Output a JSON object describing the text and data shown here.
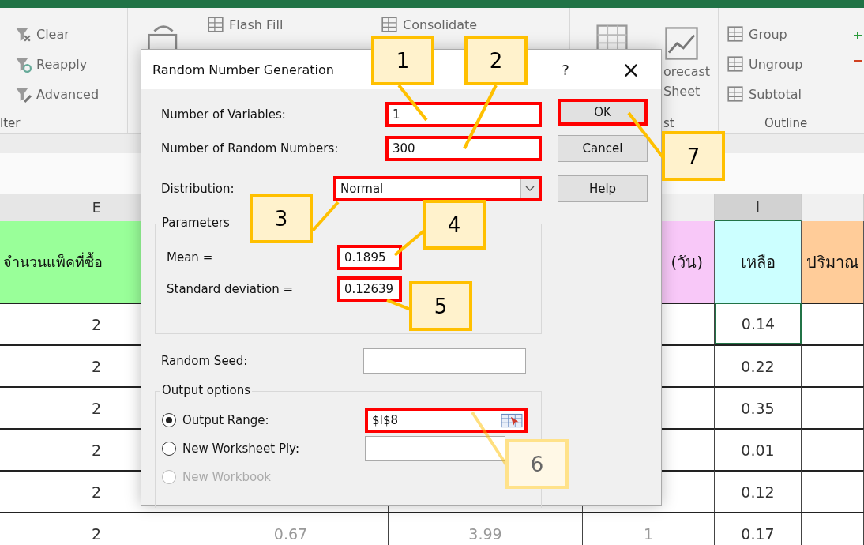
{
  "ribbon": {
    "groups": [
      {
        "kind": "small",
        "label": "lter",
        "items": [
          {
            "label": "Clear"
          },
          {
            "label": "Reapply"
          },
          {
            "label": "Advanced"
          }
        ]
      },
      {
        "kind": "small",
        "items": [
          {
            "label": "Flash Fill"
          },
          {
            "label": "Consolidate"
          }
        ]
      },
      {
        "kind": "large",
        "label": "st",
        "buttons": [
          {
            "lines": [
              "orecast",
              "Sheet"
            ]
          }
        ]
      },
      {
        "kind": "small",
        "label": "Outline",
        "items": [
          {
            "label": "Group"
          },
          {
            "label": "Ungroup"
          },
          {
            "label": "Subtotal"
          }
        ]
      }
    ]
  },
  "sheet": {
    "column_headers": [
      {
        "letter": "E",
        "selected": false
      },
      {
        "letter": "I",
        "selected": true
      }
    ],
    "header_cells": [
      {
        "text": "จำนวนแพ็คที่ซื้อ",
        "color": "#99ff99"
      },
      {
        "text": "(วัน)",
        "color": "#f8c8f8"
      },
      {
        "text": "เหลือ",
        "color": "#ccffff"
      },
      {
        "text": "ปริมาณ",
        "color": "#ffcc99"
      }
    ],
    "rows": [
      {
        "cells": [
          "2",
          null,
          null,
          null,
          "0.14",
          null
        ],
        "selected": true
      },
      {
        "cells": [
          "2",
          null,
          null,
          null,
          "0.22",
          null
        ],
        "selected": false
      },
      {
        "cells": [
          "2",
          null,
          null,
          null,
          "0.35",
          null
        ],
        "selected": false
      },
      {
        "cells": [
          "2",
          null,
          null,
          null,
          "0.01",
          null
        ],
        "selected": false
      },
      {
        "cells": [
          "2",
          null,
          null,
          null,
          "0.12",
          null
        ],
        "selected": false
      },
      {
        "cells": [
          "2",
          "0.67",
          "3.99",
          "1",
          "0.17",
          null
        ],
        "selected": false
      }
    ]
  },
  "dialog": {
    "title": "Random Number Generation",
    "help": "?",
    "close": "×",
    "fields": [
      {
        "label": "Number of Variables:",
        "value": "1",
        "highlighted": true
      },
      {
        "label": "Number of Random Numbers:",
        "value": "300",
        "highlighted": true
      }
    ],
    "distribution": {
      "label": "Distribution:",
      "value": "Normal",
      "highlighted": true
    },
    "parameters": {
      "title": "Parameters",
      "fields": [
        {
          "label": "Mean =",
          "value": "0.1895",
          "highlighted": true
        },
        {
          "label": "Standard deviation =",
          "value": "0.12639",
          "highlighted": true
        }
      ]
    },
    "random_seed": {
      "label": "Random Seed:",
      "highlighted": false
    },
    "output": {
      "title": "Output options",
      "options": [
        {
          "label": "Output Range:",
          "selected": true,
          "disabled": false,
          "field": {
            "kind": "range",
            "value": "$I$8",
            "highlighted": true
          }
        },
        {
          "label": "New Worksheet Ply:",
          "selected": false,
          "disabled": false,
          "field": {
            "kind": "text",
            "highlighted": false
          }
        },
        {
          "label": "New Workbook",
          "selected": false,
          "disabled": true
        }
      ]
    },
    "buttons": [
      {
        "label": "OK",
        "highlighted": true
      },
      {
        "label": "Cancel",
        "highlighted": false
      },
      {
        "label": "Help",
        "highlighted": false
      }
    ]
  },
  "callouts": [
    {
      "number": "1",
      "faded": false
    },
    {
      "number": "2",
      "faded": false
    },
    {
      "number": "3",
      "faded": false
    },
    {
      "number": "4",
      "faded": false
    },
    {
      "number": "5",
      "faded": false
    },
    {
      "number": "6",
      "faded": true
    },
    {
      "number": "7",
      "faded": false
    }
  ]
}
